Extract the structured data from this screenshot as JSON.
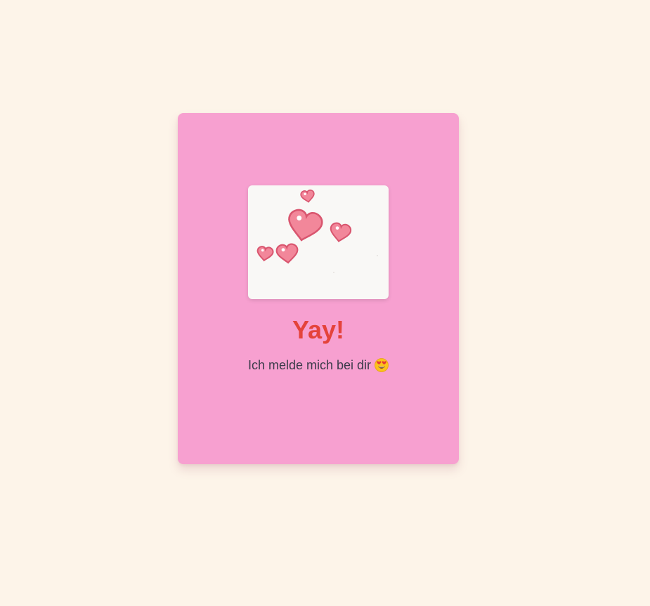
{
  "card": {
    "title": "Yay!",
    "message": "Ich melde mich bei dir",
    "emoji_icon": "heart-eyes-face-icon",
    "media_icon": "floating-hearts-icon"
  },
  "colors": {
    "page_background": "#fdf4e9",
    "card_background": "#f7a0d0",
    "title": "#e4433b",
    "message": "#3b3b4a",
    "heart_fill": "#f2879a",
    "heart_stroke": "#d9566f"
  }
}
